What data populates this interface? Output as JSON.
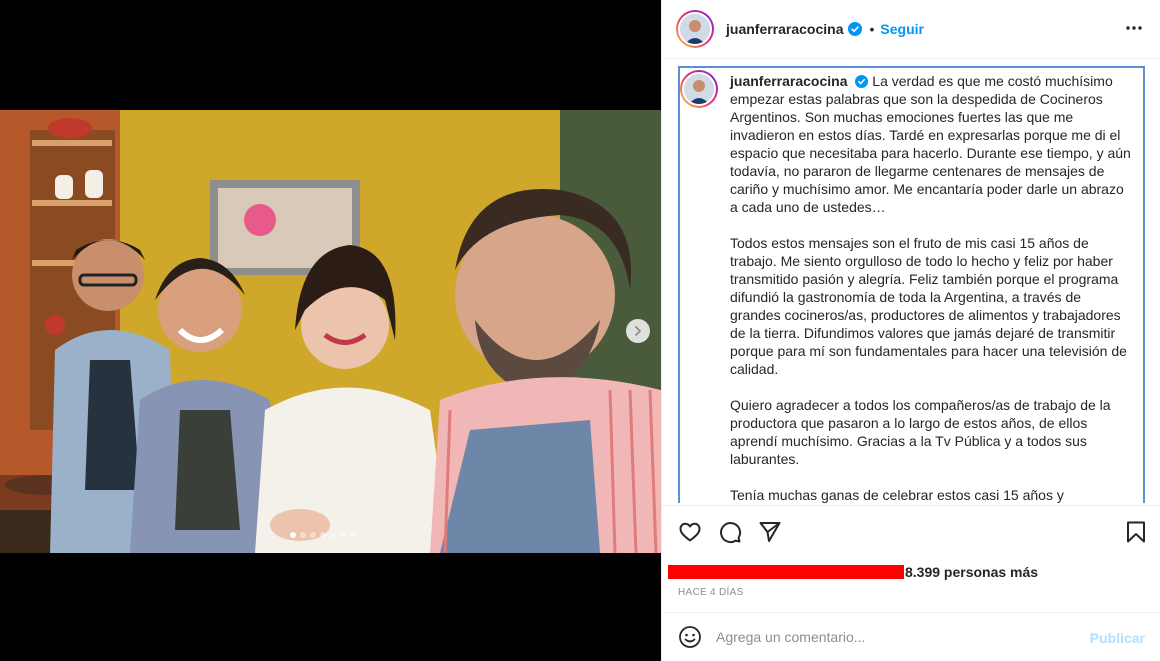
{
  "post": {
    "username": "juanferraracocina",
    "follow_label": "Seguir",
    "bullet": "•",
    "caption_paragraphs": [
      "La verdad es que me costó muchísimo empezar estas palabras que son la despedida de Cocineros Argentinos. Son muchas emociones fuertes las que me invadieron en estos días. Tardé en expresarlas porque me di el espacio que necesitaba para hacerlo. Durante ese tiempo, y aún todavía, no pararon de llegarme centenares de mensajes de cariño y muchísimo amor. Me encantaría poder darle un abrazo a cada uno de ustedes…",
      "Todos estos mensajes son el fruto de mis casi 15 años de trabajo. Me siento orgulloso de todo lo hecho y feliz por haber transmitido pasión y alegría. Feliz también porque el programa difundió la gastronomía de toda la Argentina, a través de grandes cocineros/as, productores de alimentos y trabajadores de la tierra. Difundimos valores que jamás dejaré de transmitir porque para mí son fundamentales para hacer una televisión de calidad.",
      "Quiero agradecer a todos los compañeros/as de trabajo de la productora que pasaron a lo largo de estos años, de ellos aprendí muchísimo. Gracias a la Tv Pública y a todos sus laburantes.",
      "Tenía muchas ganas de celebrar estos casi 15 años y"
    ],
    "likes_text": "8.399 personas más",
    "timestamp": "HACE 4 DÍAS",
    "comment_placeholder": "Agrega un comentario...",
    "publish_label": "Publicar"
  },
  "carousel": {
    "total_slides": 7,
    "active_index": 0
  },
  "icons": {
    "verified": "verified-badge-icon",
    "more": "more-options-icon",
    "like": "heart-icon",
    "comment": "comment-icon",
    "share": "share-icon",
    "save": "bookmark-icon",
    "emoji": "emoji-icon",
    "next": "chevron-right-icon"
  },
  "colors": {
    "accent": "#0095f6",
    "redaction": "#ff0000",
    "focus_border": "#5b8fd6"
  }
}
